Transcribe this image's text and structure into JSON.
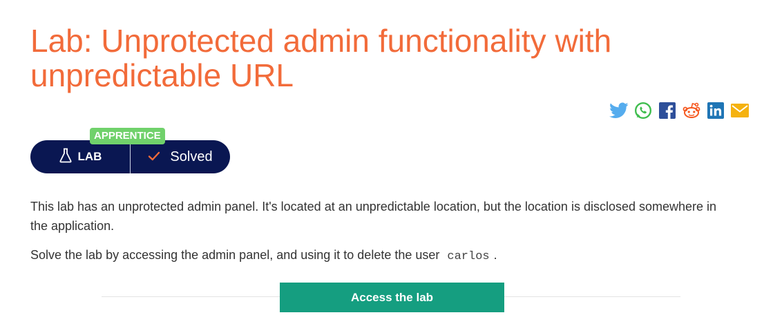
{
  "lab": {
    "title": "Lab: Unprotected admin functionality with unpredictable URL",
    "level": "APPRENTICE",
    "type_label": "LAB",
    "status_label": "Solved",
    "description_1": "This lab has an unprotected admin panel. It's located at an unpredictable location, but the location is disclosed somewhere in the application.",
    "description_2_prefix": "Solve the lab by accessing the admin panel, and using it to delete the user",
    "description_2_code": "carlos",
    "description_2_suffix": ".",
    "access_button_label": "Access the lab"
  },
  "share_icons": [
    {
      "name": "twitter-icon",
      "color": "#55acee"
    },
    {
      "name": "whatsapp-icon",
      "color": "#3fbd4e"
    },
    {
      "name": "facebook-icon",
      "color": "#2e4f9a"
    },
    {
      "name": "reddit-icon",
      "color": "#f5571e"
    },
    {
      "name": "linkedin-icon",
      "color": "#1f75b5"
    },
    {
      "name": "email-icon",
      "color": "#f5b20f"
    }
  ],
  "colors": {
    "title": "#f26b3a",
    "pill_background": "#0a1752",
    "level_tag": "#70d16b",
    "solved_check": "#f26b3a",
    "access_button": "#159e80"
  }
}
